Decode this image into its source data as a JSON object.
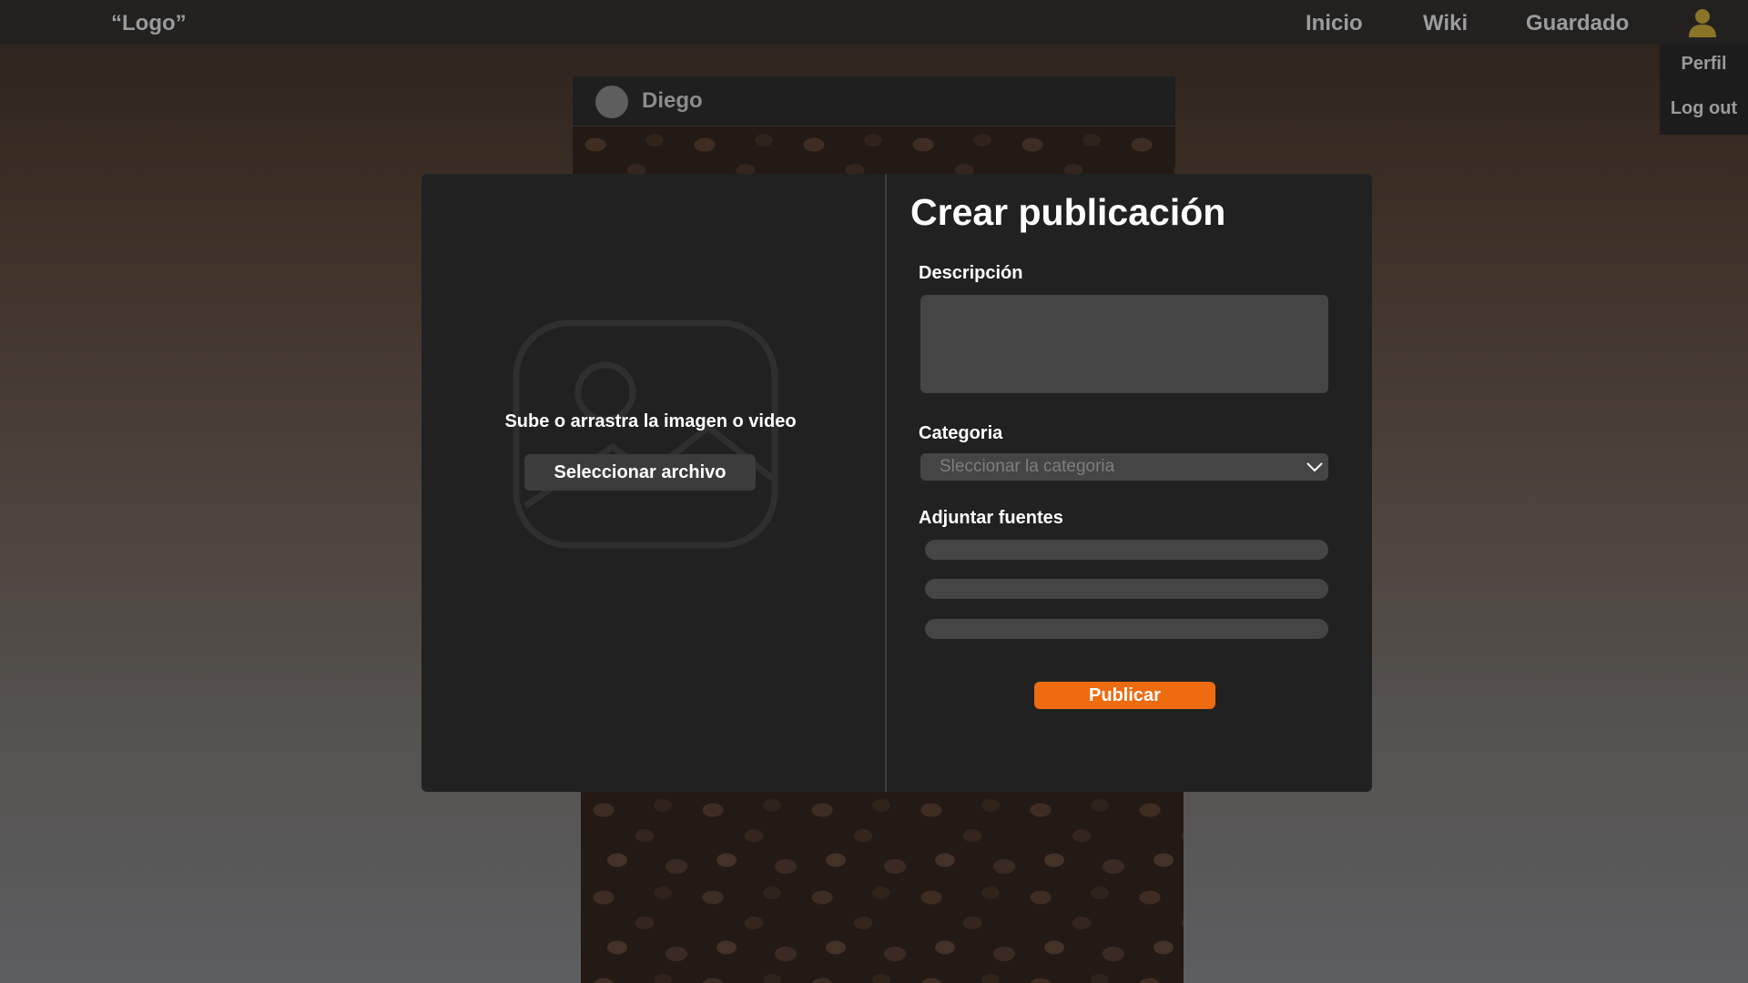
{
  "nav": {
    "logo": "“Logo”",
    "links": [
      "Inicio",
      "Wiki",
      "Guardado"
    ],
    "user_menu": [
      "Perfil",
      "Log out"
    ]
  },
  "post": {
    "username": "Diego"
  },
  "modal": {
    "upload": {
      "prompt": "Sube o arrastra la imagen o video",
      "button": "Seleccionar archivo"
    },
    "form": {
      "title": "Crear publicación",
      "description_label": "Descripción",
      "description_value": "",
      "category_label": "Categoria",
      "category_placeholder": "Sleccionar la categoria",
      "sources_label": "Adjuntar fuentes",
      "sources": [
        "",
        "",
        ""
      ],
      "publish_button": "Publicar"
    }
  },
  "colors": {
    "accent": "#ef6b0f",
    "user_icon": "#8a7428",
    "modal_bg": "#212121",
    "input_bg": "#454545"
  },
  "icons": {
    "user": "user-icon",
    "placeholder": "image-placeholder-icon",
    "dropdown": "chevron-down-icon"
  }
}
